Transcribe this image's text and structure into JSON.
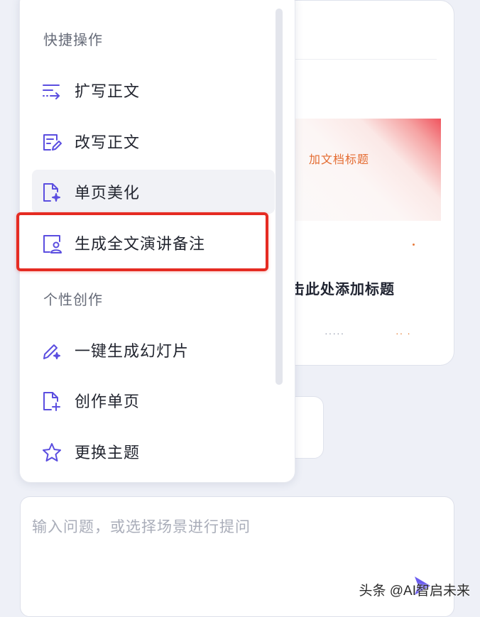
{
  "menu": {
    "sections": [
      {
        "title": "快捷操作",
        "items": [
          {
            "label": "扩写正文",
            "icon": "expand-text-icon"
          },
          {
            "label": "改写正文",
            "icon": "rewrite-icon"
          },
          {
            "label": "单页美化",
            "icon": "beautify-page-icon"
          },
          {
            "label": "生成全文演讲备注",
            "icon": "speaker-notes-icon"
          }
        ]
      },
      {
        "title": "个性创作",
        "items": [
          {
            "label": "一键生成幻灯片",
            "icon": "pen-sparkle-icon"
          },
          {
            "label": "创作单页",
            "icon": "new-page-icon"
          },
          {
            "label": "更换主题",
            "icon": "star-theme-icon"
          }
        ]
      }
    ]
  },
  "slide": {
    "thumb_placeholder": "加文档标题",
    "title_partial": "击此处添加标题",
    "dots_a": "·····",
    "dots_b": "·· ·"
  },
  "input": {
    "placeholder": "输入问题，或选择场景进行提问"
  },
  "watermark": "头条 @AI智启未来",
  "colors": {
    "accent": "#5b4ee0",
    "highlight": "#e52b22",
    "icon": "#5b4ee0"
  }
}
